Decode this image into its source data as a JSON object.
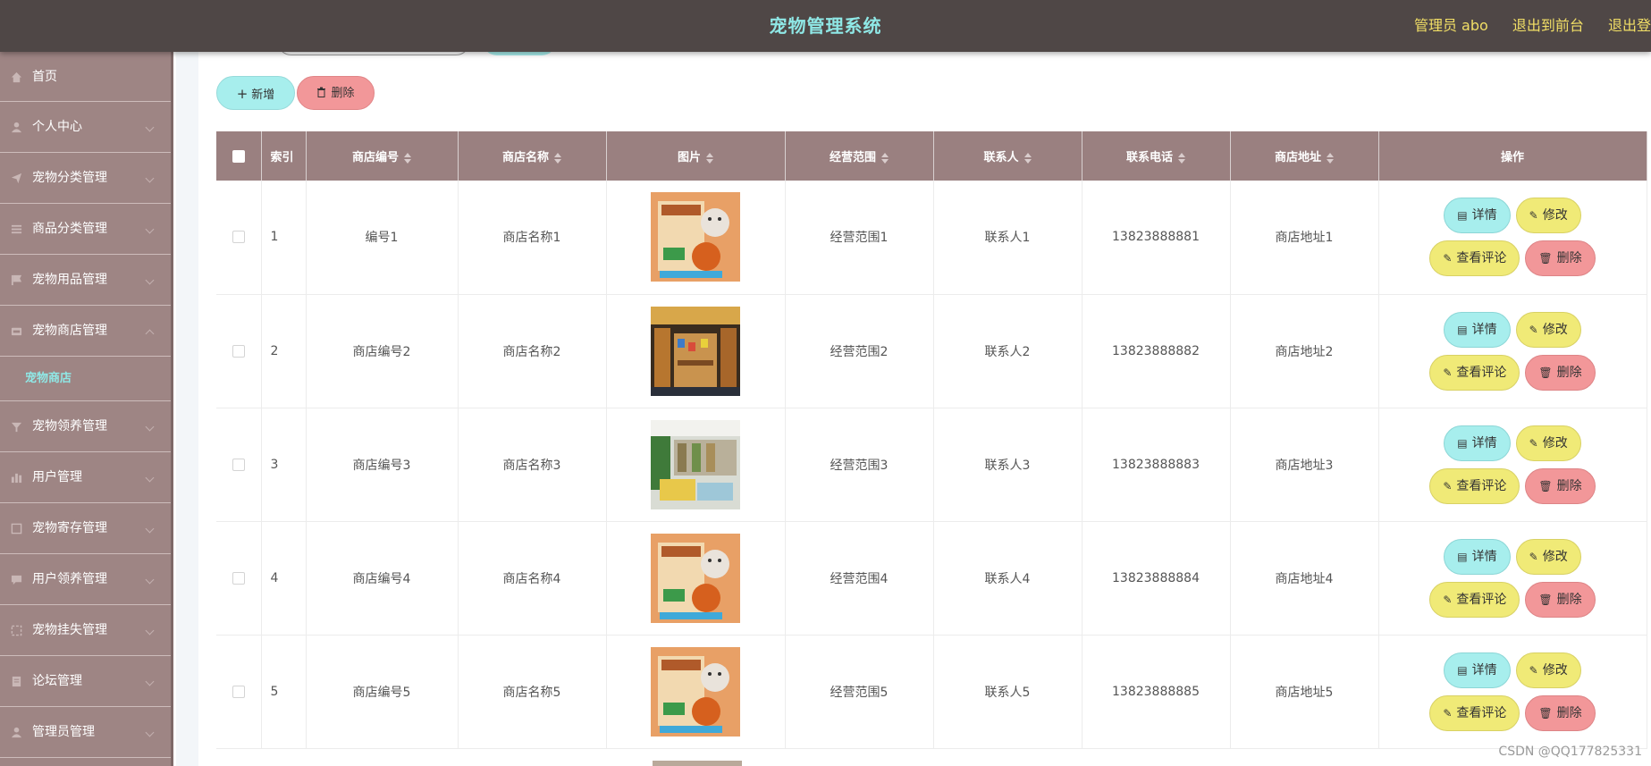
{
  "header": {
    "title": "宠物管理系统",
    "admin": "管理员 abo",
    "exit_front": "退出到前台",
    "logout": "退出登"
  },
  "sidebar": {
    "items": [
      {
        "label": "首页"
      },
      {
        "label": "个人中心"
      },
      {
        "label": "宠物分类管理"
      },
      {
        "label": "商品分类管理"
      },
      {
        "label": "宠物用品管理"
      },
      {
        "label": "宠物商店管理"
      },
      {
        "label": "宠物领养管理"
      },
      {
        "label": "用户管理"
      },
      {
        "label": "宠物寄存管理"
      },
      {
        "label": "用户领养管理"
      },
      {
        "label": "宠物挂失管理"
      },
      {
        "label": "论坛管理"
      },
      {
        "label": "管理员管理"
      }
    ],
    "active_sub": "宠物商店"
  },
  "toolbar": {
    "add_label": "新增",
    "delete_label": "删除"
  },
  "table": {
    "headers": [
      "索引",
      "商店编号",
      "商店名称",
      "图片",
      "经营范围",
      "联系人",
      "联系电话",
      "商店地址",
      "操作"
    ],
    "rows": [
      {
        "index": "1",
        "code": "编号1",
        "name": "商店名称1",
        "scope": "经营范围1",
        "contact": "联系人1",
        "phone": "13823888881",
        "address": "商店地址1"
      },
      {
        "index": "2",
        "code": "商店编号2",
        "name": "商店名称2",
        "scope": "经营范围2",
        "contact": "联系人2",
        "phone": "13823888882",
        "address": "商店地址2"
      },
      {
        "index": "3",
        "code": "商店编号3",
        "name": "商店名称3",
        "scope": "经营范围3",
        "contact": "联系人3",
        "phone": "13823888883",
        "address": "商店地址3"
      },
      {
        "index": "4",
        "code": "商店编号4",
        "name": "商店名称4",
        "scope": "经营范围4",
        "contact": "联系人4",
        "phone": "13823888884",
        "address": "商店地址4"
      },
      {
        "index": "5",
        "code": "商店编号5",
        "name": "商店名称5",
        "scope": "经营范围5",
        "contact": "联系人5",
        "phone": "13823888885",
        "address": "商店地址5"
      }
    ],
    "actions": {
      "detail": "详情",
      "edit": "修改",
      "comment": "查看评论",
      "delete": "删除"
    }
  },
  "watermark": "CSDN @QQ177825331"
}
